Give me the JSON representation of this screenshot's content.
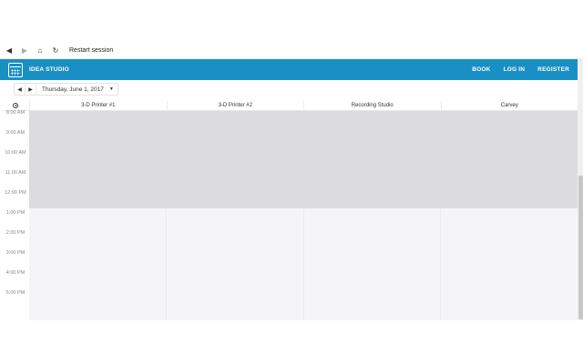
{
  "browser": {
    "back_icon": "back-arrow-icon",
    "forward_icon": "forward-arrow-icon",
    "home_icon": "home-icon",
    "reload_icon": "reload-icon",
    "restart_label": "Restart session"
  },
  "header": {
    "brand": "IDEA STUDIO",
    "nav": {
      "book": "BOOK",
      "login": "LOG IN",
      "register": "REGISTER"
    },
    "color": "#1a8fc4"
  },
  "date_bar": {
    "date": "Thursday, June 1, 2017"
  },
  "columns": [
    "3-D Printer #1",
    "3-D Printer #2",
    "Recording Studio",
    "Carvey"
  ],
  "times": [
    "8:00 AM",
    "9:00 AM",
    "10:00 AM",
    "11:00 AM",
    "12:00 PM",
    "1:00 PM",
    "2:00 PM",
    "3:00 PM",
    "4:00 PM",
    "5:00 PM"
  ]
}
